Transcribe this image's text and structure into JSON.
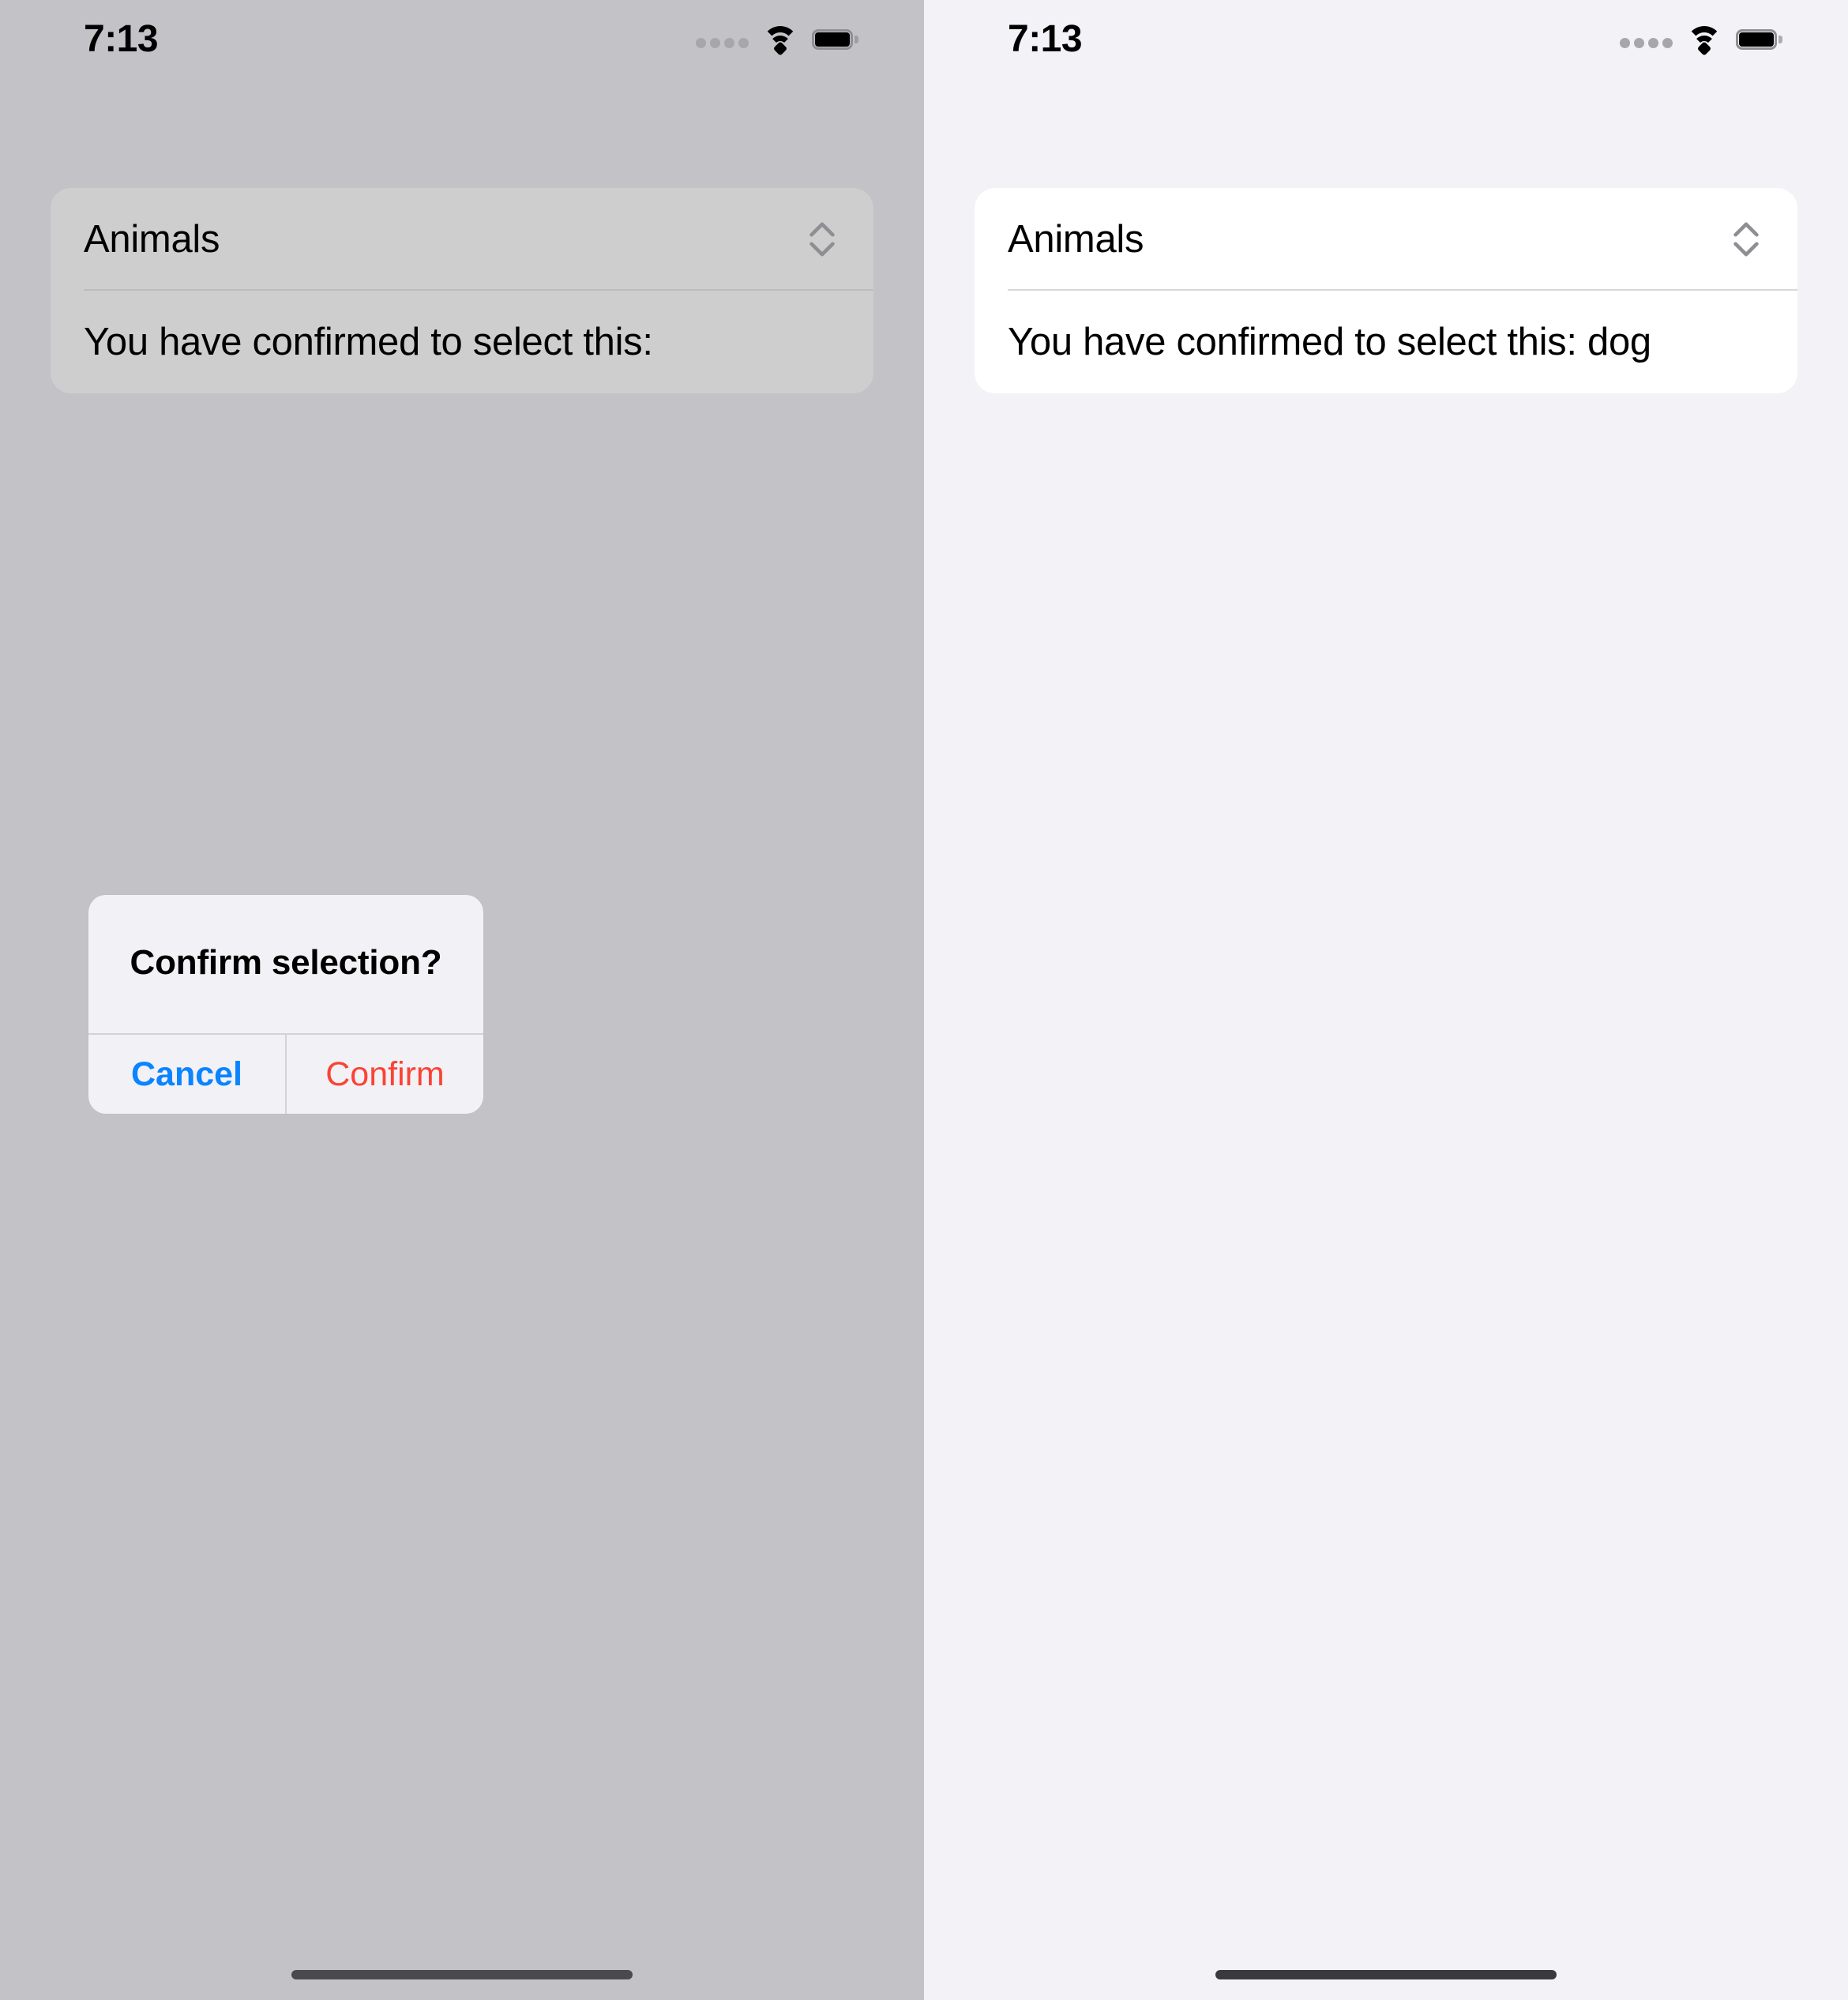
{
  "screens": [
    {
      "id": "left",
      "mode": "dimmed",
      "status": {
        "time": "7:13",
        "signal_icon": "cellular-signal-dots-icon",
        "wifi_icon": "wifi-icon",
        "battery_icon": "battery-full-icon"
      },
      "card": {
        "picker": {
          "label": "Animals",
          "chevron_icon": "chevron-up-down-icon"
        },
        "result": {
          "text": "You have confirmed to select this:"
        }
      },
      "alert": {
        "visible": true,
        "title": "Confirm selection?",
        "cancel_label": "Cancel",
        "confirm_label": "Confirm"
      },
      "home_indicator": "home-indicator"
    },
    {
      "id": "right",
      "mode": "normal",
      "status": {
        "time": "7:13",
        "signal_icon": "cellular-signal-dots-icon",
        "wifi_icon": "wifi-icon",
        "battery_icon": "battery-full-icon"
      },
      "card": {
        "picker": {
          "label": "Animals",
          "chevron_icon": "chevron-up-down-icon"
        },
        "result": {
          "text": "You have confirmed to select this: dog"
        }
      },
      "alert": {
        "visible": false
      },
      "home_indicator": "home-indicator"
    }
  ],
  "colors": {
    "cancel_blue": "#0a84ff",
    "confirm_red": "#fb4334",
    "dimmed_background": "#c3c3c7",
    "normal_background": "#f2f2f7",
    "card_dimmed": "#cececf",
    "card_normal": "#ffffff",
    "chevron_gray": "#8e8e93"
  }
}
